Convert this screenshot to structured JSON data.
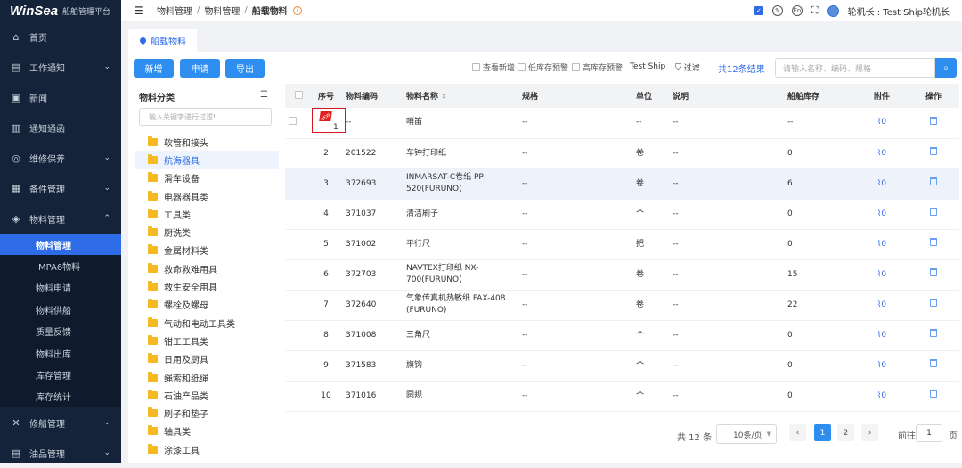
{
  "app": {
    "logo": "WinSea",
    "subtitle": "船舶管理平台"
  },
  "sidebar": {
    "items": [
      {
        "label": "首页",
        "icon": "home-icon",
        "glyph": "⌂"
      },
      {
        "label": "工作通知",
        "icon": "notice-icon",
        "glyph": "▤",
        "chevron": "⌄"
      },
      {
        "label": "新闻",
        "icon": "news-icon",
        "glyph": "▣"
      },
      {
        "label": "通知通函",
        "icon": "circular-icon",
        "glyph": "▥"
      },
      {
        "label": "维修保养",
        "icon": "maintenance-icon",
        "glyph": "◎",
        "chevron": "⌄"
      },
      {
        "label": "备件管理",
        "icon": "spare-parts-icon",
        "glyph": "▦",
        "chevron": "⌄"
      },
      {
        "label": "物料管理",
        "icon": "materials-icon",
        "glyph": "◈",
        "chevron": "⌃"
      }
    ],
    "sub_items": [
      "物料管理",
      "IMPA6物料",
      "物料申请",
      "物料供船",
      "质量反馈",
      "物料出库",
      "库存管理",
      "库存统计"
    ],
    "bottom_items": [
      {
        "label": "修船管理",
        "icon": "repair-icon",
        "glyph": "✕",
        "chevron": "⌄"
      },
      {
        "label": "油品管理",
        "icon": "oil-icon",
        "glyph": "▤",
        "chevron": "⌄"
      }
    ]
  },
  "header": {
    "breadcrumb": [
      "物料管理",
      "物料管理",
      "船载物料"
    ],
    "user": "轮机长 : Test Ship轮机长"
  },
  "tab": {
    "label": "船载物料"
  },
  "toolbar": {
    "add": "新增",
    "apply": "申请",
    "export": "导出",
    "view_new": "查看新增",
    "low_stock": "低库存预警",
    "high_stock": "高库存预警",
    "ship": "Test Ship",
    "filter": "过滤",
    "total_results": "共12条结果",
    "search_placeholder": "请输入名称、编码、规格"
  },
  "category": {
    "title": "物料分类",
    "search_placeholder": "输入关键字进行过滤!",
    "items": [
      "软管和接头",
      "航海器具",
      "滑车设备",
      "电器器具类",
      "工具类",
      "厨洗类",
      "金属材料类",
      "救命救难用具",
      "救生安全用具",
      "螺栓及螺母",
      "气动和电动工具类",
      "钳工工具类",
      "日用及厨具",
      "绳索和纸绳",
      "石油产品类",
      "刷子和垫子",
      "轴具类",
      "涂漆工具"
    ],
    "active_index": 1
  },
  "table": {
    "headers": [
      "序号",
      "物料编码",
      "物料名称",
      "规格",
      "单位",
      "说明",
      "船舶库存",
      "附件",
      "操作"
    ],
    "rows": [
      {
        "no": "1",
        "code": "--",
        "name": "哨笛",
        "spec": "--",
        "unit": "--",
        "desc": "--",
        "stock": "--",
        "att": "0",
        "new": true
      },
      {
        "no": "2",
        "code": "201522",
        "name": "车钟打印纸",
        "spec": "--",
        "unit": "卷",
        "desc": "--",
        "stock": "0",
        "att": "0"
      },
      {
        "no": "3",
        "code": "372693",
        "name": "INMARSAT-C卷纸 PP-520(FURUNO)",
        "spec": "--",
        "unit": "卷",
        "desc": "--",
        "stock": "6",
        "att": "0",
        "hl": true
      },
      {
        "no": "4",
        "code": "371037",
        "name": "清洁刷子",
        "spec": "--",
        "unit": "个",
        "desc": "--",
        "stock": "0",
        "att": "0"
      },
      {
        "no": "5",
        "code": "371002",
        "name": "平行尺",
        "spec": "--",
        "unit": "把",
        "desc": "--",
        "stock": "0",
        "att": "0"
      },
      {
        "no": "6",
        "code": "372703",
        "name": "NAVTEX打印纸 NX-700(FURUNO)",
        "spec": "--",
        "unit": "卷",
        "desc": "--",
        "stock": "15",
        "att": "0"
      },
      {
        "no": "7",
        "code": "372640",
        "name": "气象传真机热敏纸 FAX-408 (FURUNO)",
        "spec": "--",
        "unit": "卷",
        "desc": "--",
        "stock": "22",
        "att": "0"
      },
      {
        "no": "8",
        "code": "371008",
        "name": "三角尺",
        "spec": "--",
        "unit": "个",
        "desc": "--",
        "stock": "0",
        "att": "0"
      },
      {
        "no": "9",
        "code": "371583",
        "name": "旗钩",
        "spec": "--",
        "unit": "个",
        "desc": "--",
        "stock": "0",
        "att": "0"
      },
      {
        "no": "10",
        "code": "371016",
        "name": "圆规",
        "spec": "--",
        "unit": "个",
        "desc": "--",
        "stock": "0",
        "att": "0"
      }
    ]
  },
  "pagination": {
    "total": "共 12 条",
    "page_size": "10条/页",
    "pages": [
      "1",
      "2"
    ],
    "current": "1",
    "goto": "前往",
    "goto_value": "1",
    "page_suffix": "页"
  }
}
